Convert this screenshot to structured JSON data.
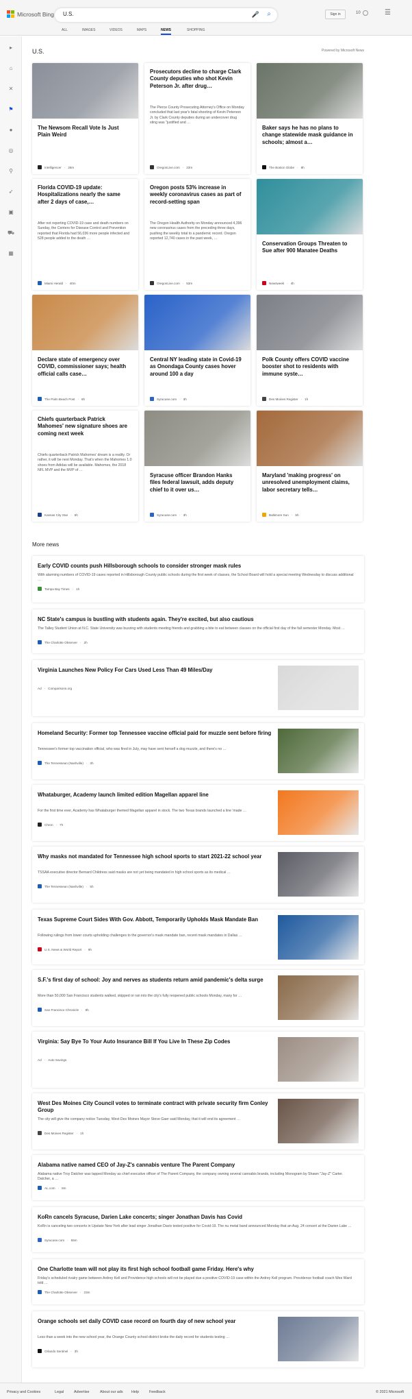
{
  "brand": {
    "name": "Microsoft Bing",
    "colors": [
      "#f25022",
      "#7fba00",
      "#00a4ef",
      "#ffb900"
    ]
  },
  "search": {
    "value": "U.S.",
    "mic_icon": "microphone-icon",
    "search_icon": "search-icon"
  },
  "header": {
    "sign_in": "Sign in",
    "rewards": "10"
  },
  "scopes": [
    {
      "label": "ALL"
    },
    {
      "label": "IMAGES"
    },
    {
      "label": "VIDEOS"
    },
    {
      "label": "MAPS"
    },
    {
      "label": "NEWS",
      "active": true
    },
    {
      "label": "SHOPPING"
    }
  ],
  "rail": {
    "items": [
      "chevron-right-icon",
      "home-icon",
      "tools-icon",
      "flag-icon",
      "location-pin-icon",
      "globe-icon",
      "running-icon",
      "rocket-icon",
      "film-icon",
      "car-icon",
      "bank-icon"
    ],
    "accent": "#174ae4"
  },
  "section": {
    "title": "U.S.",
    "powered": "Powered by Microsoft News"
  },
  "cards": [
    {
      "title": "The Newsom Recall Vote Is Just Plain Weird",
      "snippet": "",
      "source": "Intelligencer",
      "time": "26m",
      "img": "#8a8f99",
      "fav": "#222"
    },
    {
      "title": "Prosecutors decline to charge Clark County deputies who shot Kevin Peterson Jr. after drug…",
      "snippet": "The Pierce County Prosecuting Attorney's Office on Monday concluded that last year's fatal shooting of Kevin Peterson Jr. by Clark County deputies during an undercover drug sting was \"justified and …",
      "source": "OregonLive.com",
      "time": "23m",
      "img": "",
      "fav": "#333"
    },
    {
      "title": "Baker says he has no plans to change statewide mask guidance in schools; almost a…",
      "snippet": "",
      "source": "The Boston Globe",
      "time": "8h",
      "img": "#6b7468",
      "fav": "#111"
    },
    {
      "title": "Florida COVID-19 update: Hospitalizations nearly the same after 2 days of case,…",
      "snippet": "After not reporting COVID-19 case and death numbers on Sunday, the Centers for Disease Control and Prevention reported that Florida had 56,036 more people infected and 528 people added to the death …",
      "source": "Miami Herald",
      "time": "40m",
      "img": "",
      "fav": "#1a5fb4"
    },
    {
      "title": "Oregon posts 53% increase in weekly coronavirus cases as part of record-setting span",
      "snippet": "The Oregon Health Authority on Monday announced 4,396 new coronavirus cases from the preceding three days, pushing the weekly total to a pandemic record. Oregon reported 12,740 cases in the past week, …",
      "source": "OregonLive.com",
      "time": "53m",
      "img": "",
      "fav": "#333"
    },
    {
      "title": "Conservation Groups Threaten to Sue after 900 Manatee Deaths",
      "snippet": "",
      "source": "Newsweek",
      "time": "4h",
      "img": "#2f8f9c",
      "fav": "#d0021b"
    },
    {
      "title": "Declare state of emergency over COVID, commissioner says; health official calls case…",
      "snippet": "",
      "source": "The Palm Beach Post",
      "time": "6h",
      "img": "#c98a4a",
      "fav": "#1a5fb4"
    },
    {
      "title": "Central NY leading state in Covid-19 as Onondaga County cases hover around 100 a day",
      "snippet": "",
      "source": "Syracuse.com",
      "time": "3h",
      "img": "#2b63c9",
      "fav": "#2b63c9"
    },
    {
      "title": "Polk County offers COVID vaccine booster shot to residents with immune syste…",
      "snippet": "",
      "source": "Des Moines Register",
      "time": "1h",
      "img": "#7c7f86",
      "fav": "#444"
    },
    {
      "title": "Chiefs quarterback Patrick Mahomes' new signature shoes are coming next week",
      "snippet": "Chiefs quarterback Patrick Mahomes' dream is a reality. Or rather, it will be next Monday. That's when the Mahomes 1.0 shoes from Adidas will be available. Mahomes, the 2018 NFL MVP and the MVP of …",
      "source": "Kansas City Star",
      "time": "5h",
      "img": "",
      "fav": "#1a3d8f"
    },
    {
      "title": "Syracuse officer Brandon Hanks files federal lawsuit, adds deputy chief to it over us…",
      "snippet": "",
      "source": "Syracuse.com",
      "time": "3h",
      "img": "#8d8d84",
      "fav": "#2b63c9"
    },
    {
      "title": "Maryland 'making progress' on unresolved unemployment claims, labor secretary tells…",
      "snippet": "",
      "source": "Baltimore Sun",
      "time": "5h",
      "img": "#a46a3c",
      "fav": "#f0a500"
    }
  ],
  "more": {
    "title": "More news",
    "items": [
      {
        "title": "Early COVID counts push Hillsborough schools to consider stronger mask rules",
        "snippet": "With alarming numbers of COVID-19 cases reported in Hillsborough County public schools during the first week of classes, the School Board will hold a special meeting Wednesday to discuss additional …",
        "source": "Tampa Bay Times",
        "time": "1h",
        "img": "",
        "fav": "#3a8f3a"
      },
      {
        "title": "NC State's campus is bustling with students again. They're excited, but also cautious",
        "snippet": "The Talley Student Union at N.C. State University was buzzing with students meeting friends and grabbing a bite to eat between classes on the official first day of the fall semester Monday. Most …",
        "source": "The Charlotte Observer",
        "time": "2h",
        "img": "",
        "fav": "#1a5fb4"
      },
      {
        "title": "Virginia Launches New Policy For Cars Used Less Than 49 Miles/Day",
        "snippet": "",
        "source": "Comparisons.org",
        "time": "",
        "ad": "Ad",
        "img": "#d9d9d9",
        "fav": ""
      },
      {
        "title": "Homeland Security: Former top Tennessee vaccine official paid for muzzle sent before firing",
        "snippet": "Tennessee's former top vaccination official, who was fired in July, may have sent herself a dog muzzle, and there's no …",
        "source": "The Tennessean (Nashville)",
        "time": "3h",
        "img": "#4f6a3a",
        "fav": "#1a5fb4"
      },
      {
        "title": "Whataburger, Academy launch limited edition Magellan apparel line",
        "snippet": "For the first time ever, Academy has Whataburger themed Magellan apparel in stock. The two Texas brands launched a line 'made …",
        "source": "Chron",
        "time": "7h",
        "img": "#f2781f",
        "fav": "#222"
      },
      {
        "title": "Why masks not mandated for Tennessee high school sports to start 2021-22 school year",
        "snippet": "TSSAA executive director Bernard Childress said masks are not yet being mandated in high school sports as its medical …",
        "source": "The Tennessean (Nashville)",
        "time": "5h",
        "img": "#5d5d66",
        "fav": "#1a5fb4"
      },
      {
        "title": "Texas Supreme Court Sides With Gov. Abbott, Temporarily Upholds Mask Mandate Ban",
        "snippet": "Following rulings from lower courts upholding challenges to the governor's mask mandate ban, recent mask mandates in Dallas …",
        "source": "U.S. News & World Report",
        "time": "9h",
        "img": "#1f5a9e",
        "fav": "#d0021b"
      },
      {
        "title": "S.F.'s first day of school: Joy and nerves as students return amid pandemic's delta surge",
        "snippet": "More than 50,000 San Francisco students walked, skipped or ran into the city's fully reopened public schools Monday, many for …",
        "source": "San Francisco Chronicle",
        "time": "8h",
        "img": "#8a6a4a",
        "fav": "#1a5fb4"
      },
      {
        "title": "Virginia: Say Bye To Your Auto Insurance Bill If You Live In These Zip Codes",
        "snippet": "",
        "source": "Auto Savings",
        "time": "",
        "ad": "Ad",
        "img": "#9b8d83",
        "fav": ""
      },
      {
        "title": "West Des Moines City Council votes to terminate contract with private security firm Conley Group",
        "snippet": "The city will give the company notice Tuesday, West Des Moines Mayor Steve Gaer said Monday, that it will end its agreement …",
        "source": "Des Moines Register",
        "time": "1h",
        "img": "#6a5548",
        "fav": "#444"
      },
      {
        "title": "Alabama native named CEO of Jay-Z's cannabis venture The Parent Company",
        "snippet": "Alabama native Troy Datcher was tapped Monday as chief executive officer of The Parent Company, the company owning several cannabis brands, including Monogram by Shawn \"Jay-Z\" Carter. Datcher, a …",
        "source": "AL.com",
        "time": "8m",
        "img": "",
        "fav": "#1a5fb4"
      },
      {
        "title": "KoRn cancels Syracuse, Darien Lake concerts; singer Jonathan Davis has Covid",
        "snippet": "KoRn is canceling two concerts in Upstate New York after lead singer Jonathan Davis tested positive for Covid-19. The nu metal band announced Monday that an Aug. 24 concert at the Darien Lake …",
        "source": "Syracuse.com",
        "time": "55m",
        "img": "",
        "fav": "#2b63c9"
      },
      {
        "title": "One Charlotte team will not play its first high school football game Friday. Here's why",
        "snippet": "Friday's scheduled rivalry game between Ardrey Kell and Providence high schools will not be played due a positive COVID-19 case within the Ardrey Kell program. Providence football coach Wes Ward told …",
        "source": "The Charlotte Observer",
        "time": "23m",
        "img": "",
        "fav": "#1a5fb4"
      },
      {
        "title": "Orange schools set daily COVID case record on fourth day of new school year",
        "snippet": "Less than a week into the new school year, the Orange County school district broke the daily record for students testing …",
        "source": "Orlando Sentinel",
        "time": "3h",
        "img": "#6e7c95",
        "fav": "#111"
      }
    ]
  },
  "footer": {
    "links": [
      "Privacy and Cookies",
      "Legal",
      "Advertise",
      "About our ads",
      "Help",
      "Feedback"
    ],
    "copyright": "© 2021 Microsoft"
  }
}
